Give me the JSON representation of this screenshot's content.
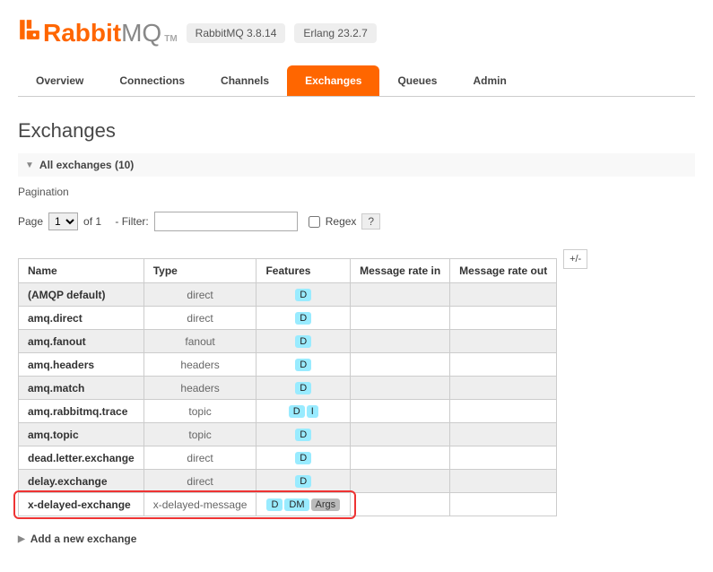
{
  "header": {
    "logo_rabbit": "Rabbit",
    "logo_mq": "MQ",
    "logo_tm": "TM",
    "version_badge": "RabbitMQ 3.8.14",
    "erlang_badge": "Erlang 23.2.7"
  },
  "tabs": [
    {
      "label": "Overview",
      "active": false
    },
    {
      "label": "Connections",
      "active": false
    },
    {
      "label": "Channels",
      "active": false
    },
    {
      "label": "Exchanges",
      "active": true
    },
    {
      "label": "Queues",
      "active": false
    },
    {
      "label": "Admin",
      "active": false
    }
  ],
  "page_title": "Exchanges",
  "section_title": "All exchanges (10)",
  "pagination": {
    "label_page": "Page",
    "select_value": "1",
    "of_text": "of 1",
    "filter_label": "- Filter:",
    "filter_value": "",
    "regex_label": "Regex",
    "help_label": "?"
  },
  "columns": [
    "Name",
    "Type",
    "Features",
    "Message rate in",
    "Message rate out"
  ],
  "plusminus": "+/-",
  "rows": [
    {
      "name": "(AMQP default)",
      "type": "direct",
      "features": [
        "D"
      ]
    },
    {
      "name": "amq.direct",
      "type": "direct",
      "features": [
        "D"
      ]
    },
    {
      "name": "amq.fanout",
      "type": "fanout",
      "features": [
        "D"
      ]
    },
    {
      "name": "amq.headers",
      "type": "headers",
      "features": [
        "D"
      ]
    },
    {
      "name": "amq.match",
      "type": "headers",
      "features": [
        "D"
      ]
    },
    {
      "name": "amq.rabbitmq.trace",
      "type": "topic",
      "features": [
        "D",
        "I"
      ]
    },
    {
      "name": "amq.topic",
      "type": "topic",
      "features": [
        "D"
      ]
    },
    {
      "name": "dead.letter.exchange",
      "type": "direct",
      "features": [
        "D"
      ]
    },
    {
      "name": "delay.exchange",
      "type": "direct",
      "features": [
        "D"
      ]
    },
    {
      "name": "x-delayed-exchange",
      "type": "x-delayed-message",
      "features": [
        "D",
        "DM",
        "Args"
      ]
    }
  ],
  "subheading_pagination": "Pagination",
  "add_new_label": "Add a new exchange"
}
